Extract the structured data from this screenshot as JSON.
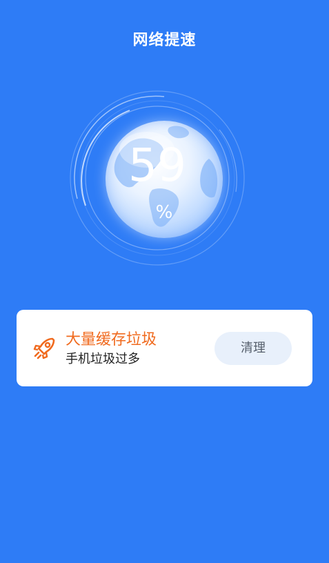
{
  "header": {
    "title": "网络提速"
  },
  "speed_meter": {
    "value": "59",
    "unit": "%"
  },
  "junk_card": {
    "icon": "rocket-icon",
    "title": "大量缓存垃圾",
    "subtitle": "手机垃圾过多",
    "button_label": "清理"
  },
  "colors": {
    "background": "#2E7CF6",
    "card_background": "#FFFFFF",
    "accent_orange": "#F06A1E",
    "button_background": "#E8F0FB"
  }
}
